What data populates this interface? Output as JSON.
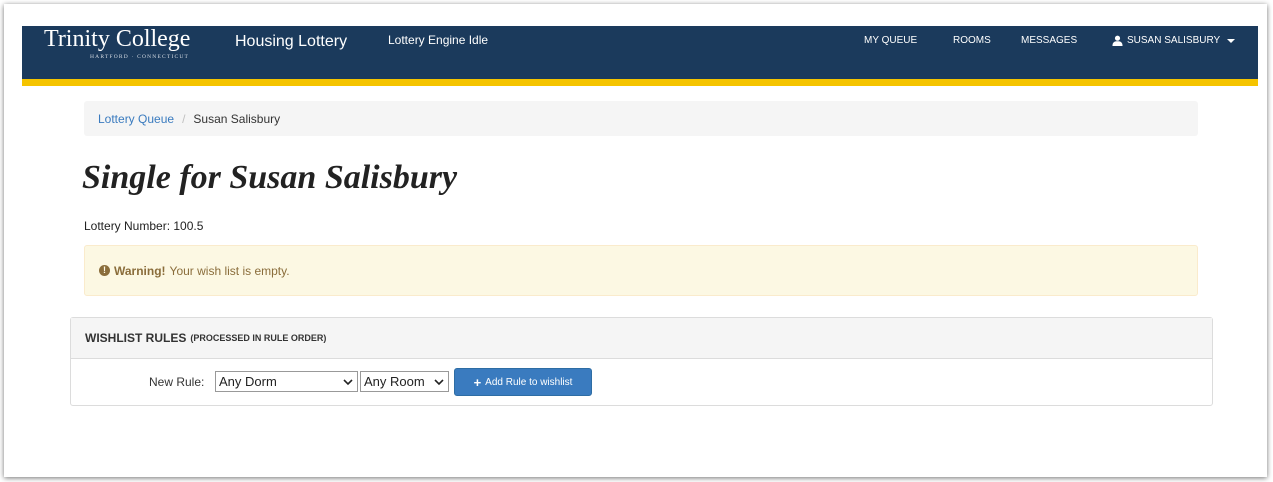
{
  "navbar": {
    "brand_name": "Trinity College",
    "brand_tagline": "HARTFORD · CONNECTICUT",
    "app_title": "Housing Lottery",
    "engine_status": "Lottery Engine Idle",
    "links": {
      "my_queue": "MY QUEUE",
      "rooms": "ROOMS",
      "messages": "MESSAGES",
      "user": "SUSAN SALISBURY"
    },
    "icons": {
      "user": "user-icon",
      "caret": "caret-down-icon"
    },
    "colors": {
      "background": "#1b3a5c",
      "accent": "#f5c400"
    }
  },
  "breadcrumb": {
    "link": "Lottery Queue",
    "separator": "/",
    "current": "Susan Salisbury"
  },
  "page": {
    "title": "Single for Susan Salisbury",
    "lottery_number": "Lottery Number: 100.5"
  },
  "alert": {
    "icon": "exclamation-circle-icon",
    "strong": "Warning!",
    "text": "Your wish list is empty."
  },
  "wishlist": {
    "heading": "WISHLIST RULES",
    "subheading": "(PROCESSED IN RULE ORDER)",
    "new_rule_label": "New Rule:",
    "dorm_select": "Any Dorm",
    "room_select": "Any Room",
    "add_button": "Add Rule to wishlist",
    "add_icon": "plus-icon"
  }
}
